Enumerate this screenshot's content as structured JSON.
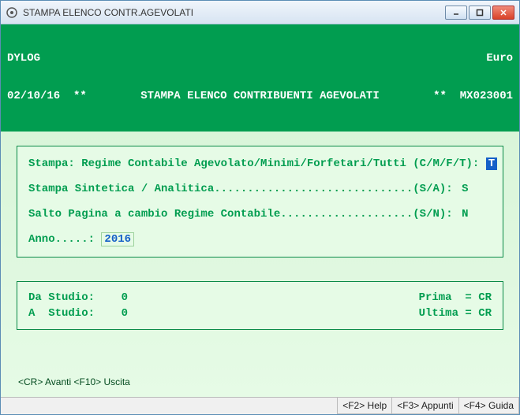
{
  "window": {
    "title": "STAMPA ELENCO CONTR.AGEVOLATI"
  },
  "header": {
    "company": "DYLOG",
    "currency": "Euro",
    "date": "02/10/16",
    "stars_left": "**",
    "title": "STAMPA ELENCO CONTRIBUENTI AGEVOLATI",
    "stars_right": "**",
    "code": "MX023001"
  },
  "form": {
    "line1_label": "Stampa: Regime Contabile Agevolato/Minimi/Forfetari/Tutti (C/M/F/T): ",
    "line1_val": "T",
    "line2_label": "Stampa Sintetica / Analitica..............................(S/A): ",
    "line2_val": "S",
    "line3_label": "Salto Pagina a cambio Regime Contabile....................(S/N): ",
    "line3_val": "N",
    "anno_label": "Anno.....: ",
    "anno_val": "2016"
  },
  "studio": {
    "da_label": "Da Studio: ",
    "da_val": "   0",
    "a_label": "A  Studio: ",
    "a_val": "   0",
    "prima": "Prima  = CR",
    "ultima": "Ultima = CR"
  },
  "keys": {
    "left": "<CR> Avanti  <F10> Uscita"
  },
  "status": {
    "f2": "<F2> Help",
    "f3": "<F3> Appunti",
    "f4": "<F4> Guida"
  }
}
